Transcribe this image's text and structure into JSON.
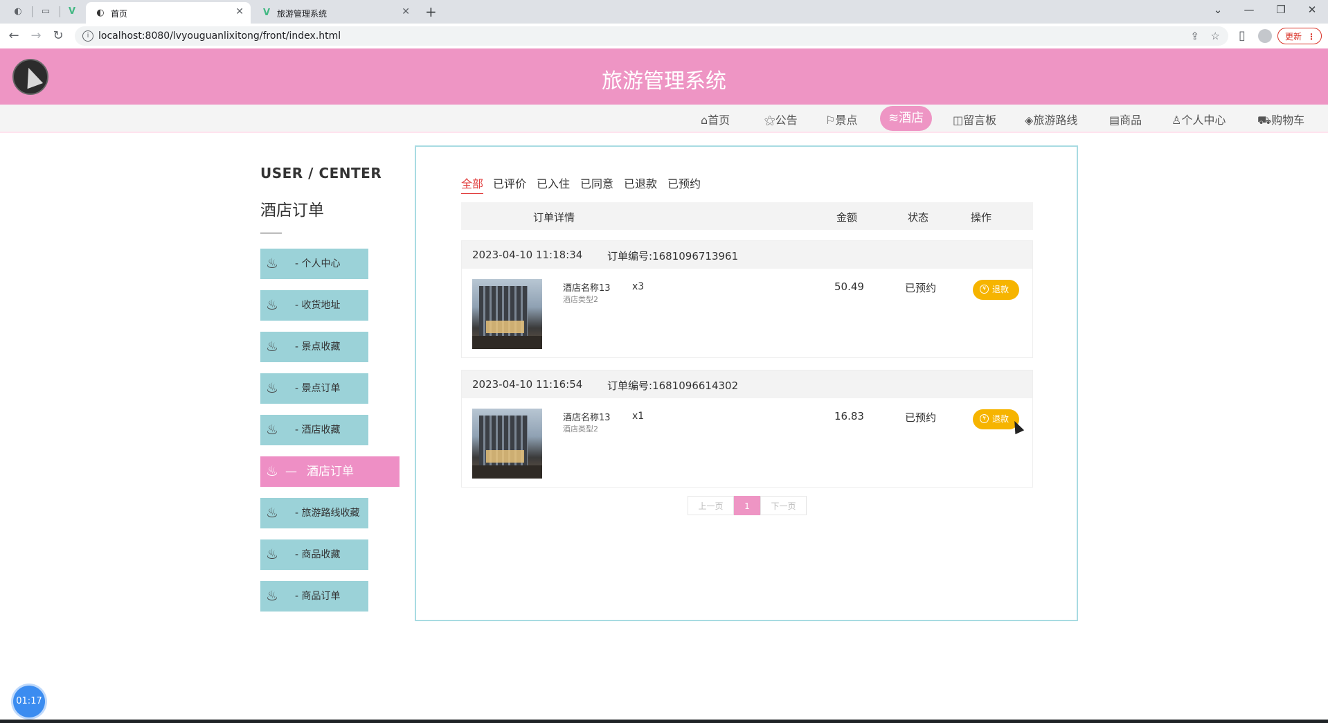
{
  "browser": {
    "tabs": [
      {
        "title": "首页",
        "active": true
      },
      {
        "title": "旅游管理系统",
        "active": false
      }
    ],
    "url": "localhost:8080/lvyouguanlixitong/front/index.html",
    "update_label": "更新"
  },
  "site": {
    "title": "旅游管理系统",
    "nav": [
      {
        "icon": "home-icon",
        "label": "首页"
      },
      {
        "icon": "announce-icon",
        "label": "公告"
      },
      {
        "icon": "flag-icon",
        "label": "景点"
      },
      {
        "icon": "hotel-icon",
        "label": "酒店",
        "active": true
      },
      {
        "icon": "message-board-icon",
        "label": "留言板"
      },
      {
        "icon": "route-icon",
        "label": "旅游路线"
      },
      {
        "icon": "goods-icon",
        "label": "商品"
      },
      {
        "icon": "user-icon",
        "label": "个人中心"
      },
      {
        "icon": "cart-icon",
        "label": "购物车"
      }
    ]
  },
  "sidebar": {
    "heading": "USER / CENTER",
    "subheading": "酒店订单",
    "items": [
      {
        "label": "个人中心"
      },
      {
        "label": "收货地址"
      },
      {
        "label": "景点收藏"
      },
      {
        "label": "景点订单"
      },
      {
        "label": "酒店收藏"
      },
      {
        "label": "酒店订单",
        "active": true
      },
      {
        "label": "旅游路线收藏"
      },
      {
        "label": "商品收藏"
      },
      {
        "label": "商品订单"
      }
    ]
  },
  "orders_panel": {
    "status_tabs": [
      "全部",
      "已评价",
      "已入住",
      "已同意",
      "已退款",
      "已预约"
    ],
    "active_tab": "全部",
    "columns": [
      "订单详情",
      "金额",
      "状态",
      "操作"
    ],
    "orders": [
      {
        "time": "2023-04-10 11:18:34",
        "order_no": "订单编号:1681096713961",
        "hotel_name": "酒店名称13",
        "hotel_type": "酒店类型2",
        "quantity": "x3",
        "amount": "50.49",
        "status": "已预约",
        "action": "退款"
      },
      {
        "time": "2023-04-10 11:16:54",
        "order_no": "订单编号:1681096614302",
        "hotel_name": "酒店名称13",
        "hotel_type": "酒店类型2",
        "quantity": "x1",
        "amount": "16.83",
        "status": "已预约",
        "action": "退款"
      }
    ],
    "pager": {
      "prev": "上一页",
      "current": "1",
      "next": "下一页"
    }
  },
  "timer": "01:17",
  "colors": {
    "header_pink": "#ee95c4",
    "sidebar_teal": "#9bd2d8",
    "refund_orange": "#f6b400",
    "active_tab_red": "#e03a3a"
  }
}
